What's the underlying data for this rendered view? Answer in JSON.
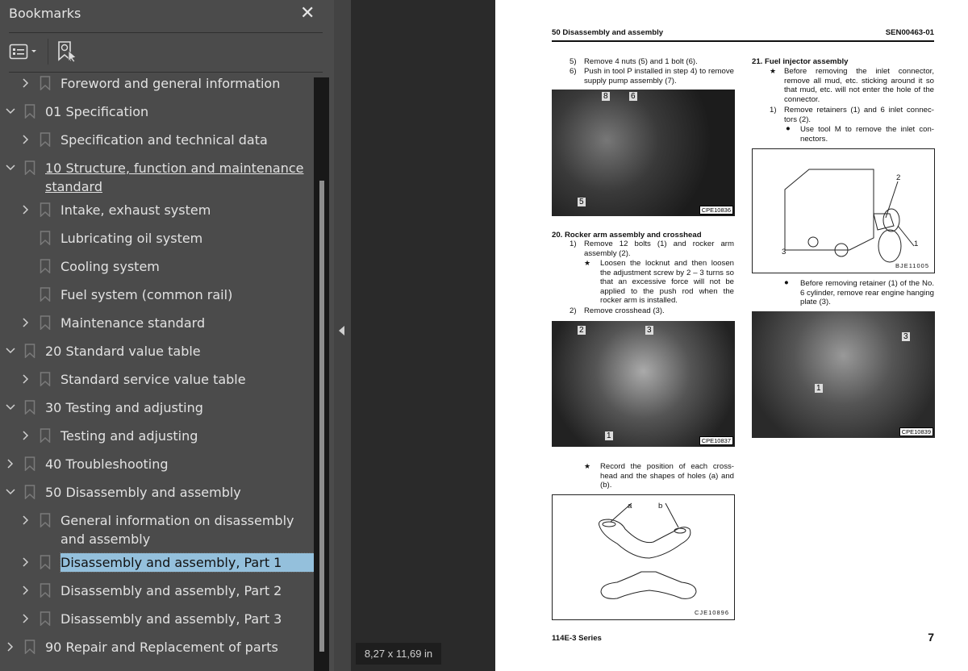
{
  "sidebar": {
    "title": "Bookmarks",
    "close_icon": "close-icon",
    "toolbar": {
      "view_icon": "list-options-icon",
      "find_icon": "find-current-bookmark-icon"
    },
    "tree": [
      {
        "label": "Foreword and general information",
        "level": 1,
        "state": "collapsed"
      },
      {
        "label": "01 Specification",
        "level": 0,
        "state": "expanded"
      },
      {
        "label": "Specification and technical data",
        "level": 1,
        "state": "collapsed"
      },
      {
        "label": "10 Structure, function and maintenance standard",
        "level": 0,
        "state": "expanded",
        "underlined": true
      },
      {
        "label": "Intake, exhaust system",
        "level": 1,
        "state": "collapsed"
      },
      {
        "label": "Lubricating oil system",
        "level": 1,
        "state": "leaf"
      },
      {
        "label": "Cooling system",
        "level": 1,
        "state": "leaf"
      },
      {
        "label": "Fuel system (common rail)",
        "level": 1,
        "state": "leaf"
      },
      {
        "label": "Maintenance standard",
        "level": 1,
        "state": "collapsed"
      },
      {
        "label": "20 Standard value table",
        "level": 0,
        "state": "expanded"
      },
      {
        "label": "Standard service value table",
        "level": 1,
        "state": "collapsed"
      },
      {
        "label": "30 Testing and adjusting",
        "level": 0,
        "state": "expanded"
      },
      {
        "label": "Testing and adjusting",
        "level": 1,
        "state": "collapsed"
      },
      {
        "label": "40 Troubleshooting",
        "level": 0,
        "state": "collapsed"
      },
      {
        "label": "50 Disassembly and assembly",
        "level": 0,
        "state": "expanded"
      },
      {
        "label": "General information on disassembly and assembly",
        "level": 1,
        "state": "collapsed"
      },
      {
        "label": "Disassembly and assembly, Part 1",
        "level": 1,
        "state": "collapsed",
        "selected": true
      },
      {
        "label": "Disassembly and assembly, Part 2",
        "level": 1,
        "state": "collapsed"
      },
      {
        "label": "Disassembly and assembly, Part 3",
        "level": 1,
        "state": "collapsed"
      },
      {
        "label": "90 Repair and Replacement of parts",
        "level": 0,
        "state": "collapsed"
      }
    ],
    "highlight_color": "#94c0dc"
  },
  "page_size": "8,27 x 11,69 in",
  "document": {
    "header_left": "50 Disassembly and assembly",
    "header_right": "SEN00463-01",
    "footer_left": "114E-3 Series",
    "page_number": "7",
    "left": {
      "step5_n": "5)",
      "step5": "Remove 4 nuts (5) and 1 bolt (6).",
      "step6_n": "6)",
      "step6": "Push in tool P installed in step 4) to remove supply pump assembly (7).",
      "photo1_tag": "CPE10836",
      "photo1_labels": [
        "8",
        "6",
        "5"
      ],
      "sec20": "20.  Rocker arm assembly and crosshead",
      "s1_n": "1)",
      "s1": "Remove 12 bolts (1) and rocker arm assembly (2).",
      "star1": "Loosen the locknut and then loosen the adjustment screw by 2 – 3 turns so that an excessive force will not be applied to the push rod when the rocker arm is installed.",
      "s2_n": "2)",
      "s2": "Remove crosshead (3).",
      "photo2_tag": "CPE10837",
      "photo2_labels": [
        "2",
        "3",
        "1"
      ],
      "star2": "Record the position of each cross-head and the shapes of holes (a) and (b).",
      "fig3_tag": "CJE10896",
      "fig3_labels": [
        "a",
        "b"
      ]
    },
    "right": {
      "sec21": "21.  Fuel injector assembly",
      "star1": "Before removing the inlet connector, remove all mud, etc. sticking around it so that mud, etc. will not enter the hole of the connector.",
      "s1_n": "1)",
      "s1": "Remove retainers (1) and 6 inlet connec-tors (2).",
      "dot1": "Use tool M to remove the inlet con-nectors.",
      "fig1_tag": "BJE11005",
      "fig1_labels": [
        "2",
        "1",
        "3"
      ],
      "dot2": "Before removing retainer (1) of the No. 6 cylinder, remove rear engine hanging plate (3).",
      "photo2_tag": "CPE10839",
      "photo2_labels": [
        "3",
        "1"
      ]
    }
  }
}
